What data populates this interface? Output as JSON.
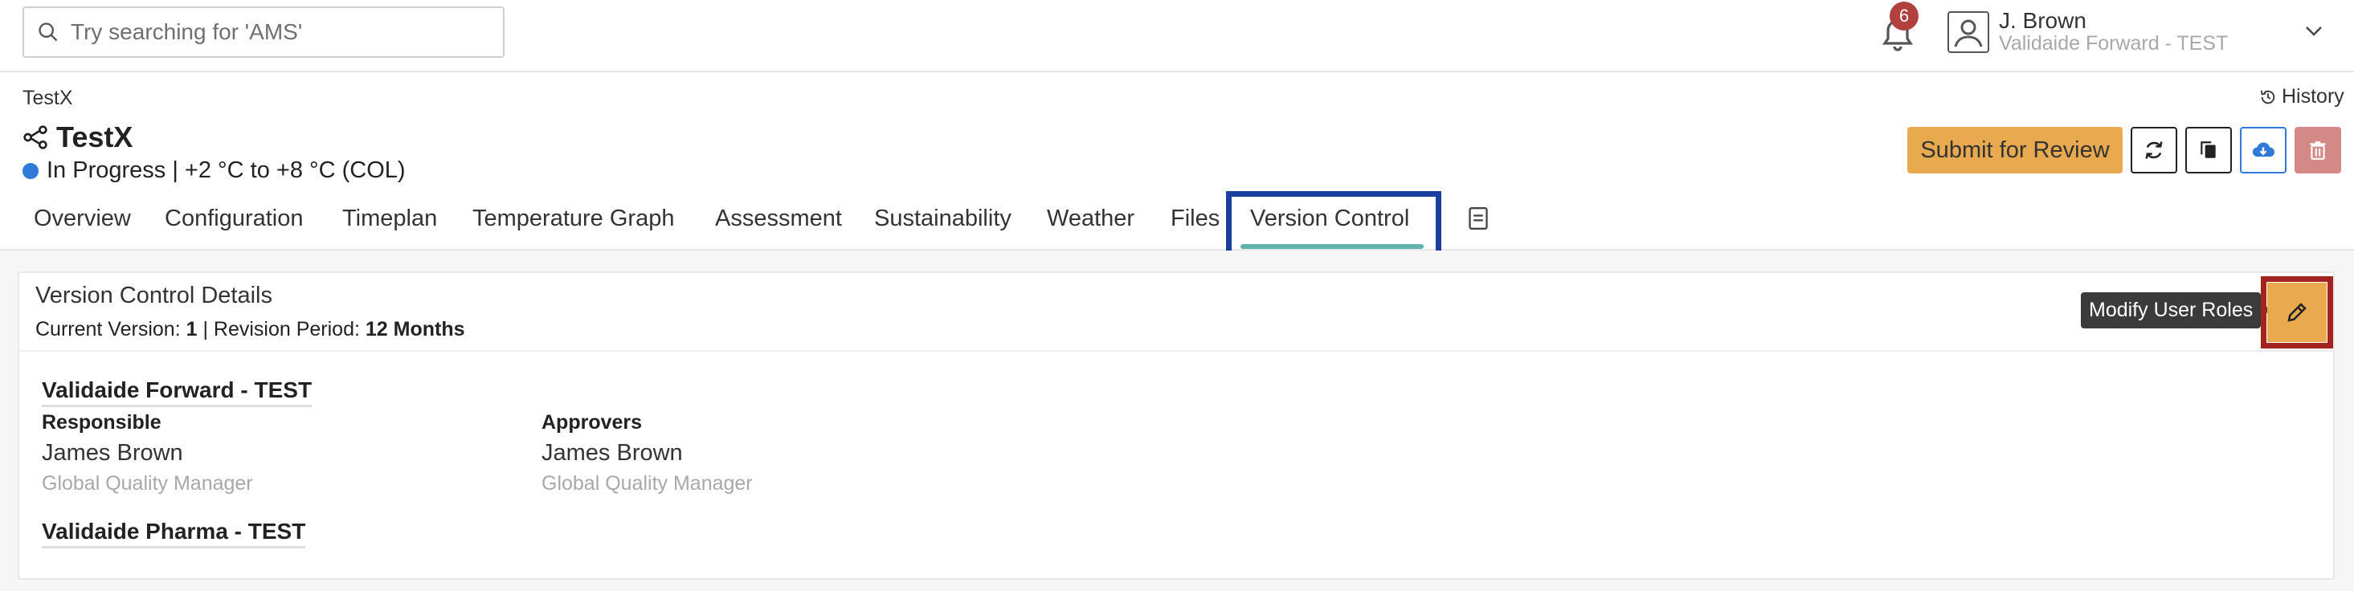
{
  "search": {
    "placeholder": "Try searching for 'AMS'"
  },
  "notifications": {
    "count": "6"
  },
  "user": {
    "name": "J. Brown",
    "org": "Validaide Forward - TEST"
  },
  "header": {
    "breadcrumb": "TestX",
    "history_label": "History",
    "title": "TestX",
    "status": "In Progress | +2 °C to +8 °C (COL)",
    "submit_label": "Submit for Review"
  },
  "tabs": [
    {
      "label": "Overview"
    },
    {
      "label": "Configuration"
    },
    {
      "label": "Timeplan"
    },
    {
      "label": "Temperature Graph"
    },
    {
      "label": "Assessment"
    },
    {
      "label": "Sustainability"
    },
    {
      "label": "Weather"
    },
    {
      "label": "Files"
    },
    {
      "label": "Version Control"
    }
  ],
  "version_control": {
    "title": "Version Control Details",
    "current_version_label": "Current Version:",
    "current_version": "1",
    "separator": "|",
    "revision_label": "Revision Period:",
    "revision_period": "12 Months",
    "tooltip": "Modify User Roles",
    "groups": [
      {
        "name": "Validaide Forward - TEST",
        "responsible_label": "Responsible",
        "responsible_name": "James Brown",
        "responsible_title": "Global Quality Manager",
        "approvers_label": "Approvers",
        "approver_name": "James Brown",
        "approver_title": "Global Quality Manager"
      },
      {
        "name": "Validaide Pharma - TEST"
      }
    ]
  },
  "colors": {
    "accent_orange": "#e9a94f",
    "status_blue": "#2f7ad8",
    "tab_underline": "#5fb3ad",
    "highlight_blue": "#1a3f9c",
    "highlight_red": "#a3241f"
  }
}
